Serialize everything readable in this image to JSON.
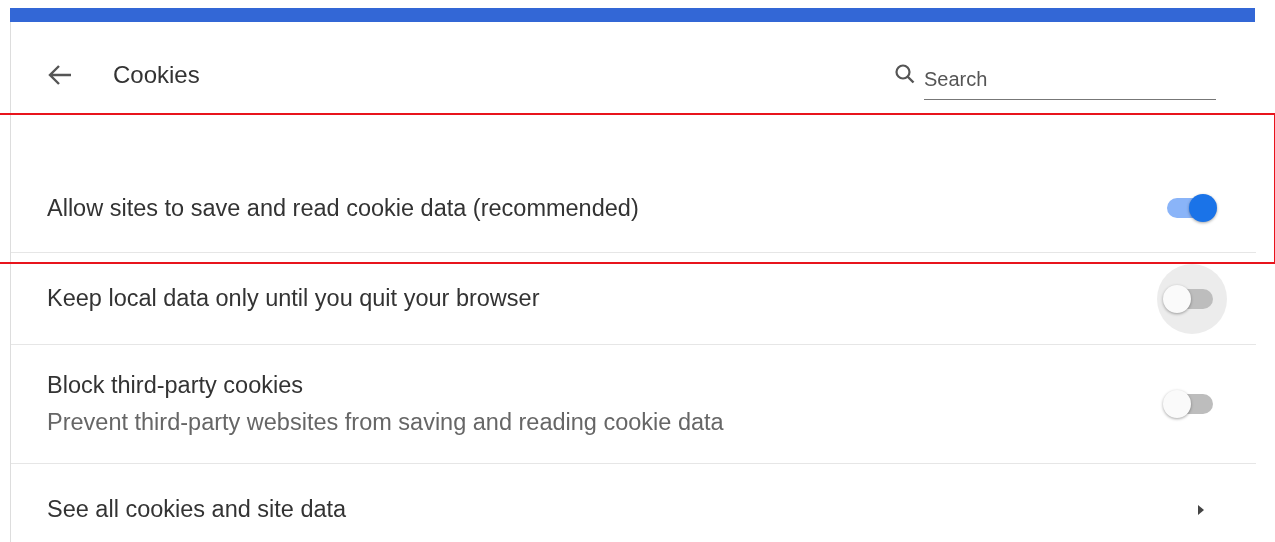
{
  "header": {
    "title": "Cookies",
    "search": {
      "placeholder": "Search"
    }
  },
  "rows": [
    {
      "kind": "toggle",
      "label": "Allow sites to save and read cookie data (recommended)",
      "on": true,
      "focused": false,
      "highlighted": true
    },
    {
      "kind": "toggle",
      "label": "Keep local data only until you quit your browser",
      "on": false,
      "focused": true,
      "highlighted": false
    },
    {
      "kind": "toggle",
      "label": "Block third-party cookies",
      "sublabel": "Prevent third-party websites from saving and reading cookie data",
      "on": false,
      "focused": false,
      "highlighted": false
    },
    {
      "kind": "link",
      "label": "See all cookies and site data"
    }
  ]
}
